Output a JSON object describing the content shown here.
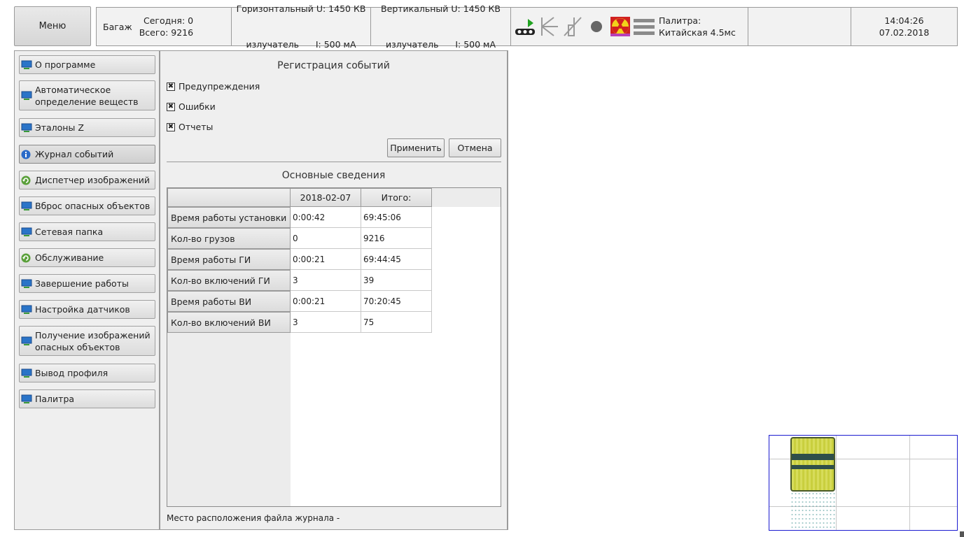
{
  "menu_label": "Меню",
  "topbar": {
    "baggage_label": "Багаж",
    "today": "Сегодня: 0",
    "total": "Всего: 9216",
    "horizontal": {
      "line1": "Горизонтальный U: 1450 КВ",
      "line2": "излучатель      I: 500 мА"
    },
    "vertical": {
      "line1": "Вертикальный U: 1450 КВ",
      "line2": "излучатель      I: 500 мА"
    },
    "palette_line1": "Палитра:",
    "palette_line2": "Китайская 4.5мс",
    "time": "14:04:26",
    "date": "07.02.2018",
    "icons": [
      "conveyor-play-icon",
      "horizontal-source-icon",
      "vertical-source-icon",
      "record-dot-icon",
      "radiation-icon",
      "menu-lines-icon"
    ]
  },
  "nav": [
    {
      "label": "О программе",
      "icon": "monitor-icon"
    },
    {
      "label": "Автоматическое определение веществ",
      "icon": "monitor-icon"
    },
    {
      "label": "Эталоны Z",
      "icon": "monitor-icon"
    },
    {
      "label": "Журнал событий",
      "icon": "info-icon",
      "active": true
    },
    {
      "label": "Диспетчер изображений",
      "icon": "refresh-icon"
    },
    {
      "label": "Вброс опасных объектов",
      "icon": "monitor-icon"
    },
    {
      "label": "Сетевая папка",
      "icon": "monitor-icon"
    },
    {
      "label": "Обслуживание",
      "icon": "refresh-icon"
    },
    {
      "label": "Завершение работы",
      "icon": "monitor-icon"
    },
    {
      "label": "Настройка датчиков",
      "icon": "monitor-icon"
    },
    {
      "label": "Получение изображений опасных объектов",
      "icon": "monitor-icon"
    },
    {
      "label": "Вывод профиля",
      "icon": "monitor-icon"
    },
    {
      "label": "Палитра",
      "icon": "monitor-icon"
    }
  ],
  "events": {
    "title": "Регистрация событий",
    "checkboxes": [
      {
        "label": "Предупреждения",
        "checked": true
      },
      {
        "label": "Ошибки",
        "checked": true
      },
      {
        "label": "Отчеты",
        "checked": true
      }
    ],
    "apply_label": "Применить",
    "cancel_label": "Отмена"
  },
  "info": {
    "title": "Основные сведения",
    "columns": [
      "",
      "2018-02-07",
      "Итого:"
    ],
    "rows": [
      {
        "name": "Время работы установки",
        "day": "0:00:42",
        "total": "69:45:06"
      },
      {
        "name": "Кол-во грузов",
        "day": "0",
        "total": "9216"
      },
      {
        "name": "Время работы ГИ",
        "day": "0:00:21",
        "total": "69:44:45"
      },
      {
        "name": "Кол-во включений ГИ",
        "day": "3",
        "total": "39"
      },
      {
        "name": "Время работы ВИ",
        "day": "0:00:21",
        "total": "70:20:45"
      },
      {
        "name": "Кол-во включений ВИ",
        "day": "3",
        "total": "75"
      }
    ],
    "log_path_label": "Место расположения файла журнала -"
  }
}
